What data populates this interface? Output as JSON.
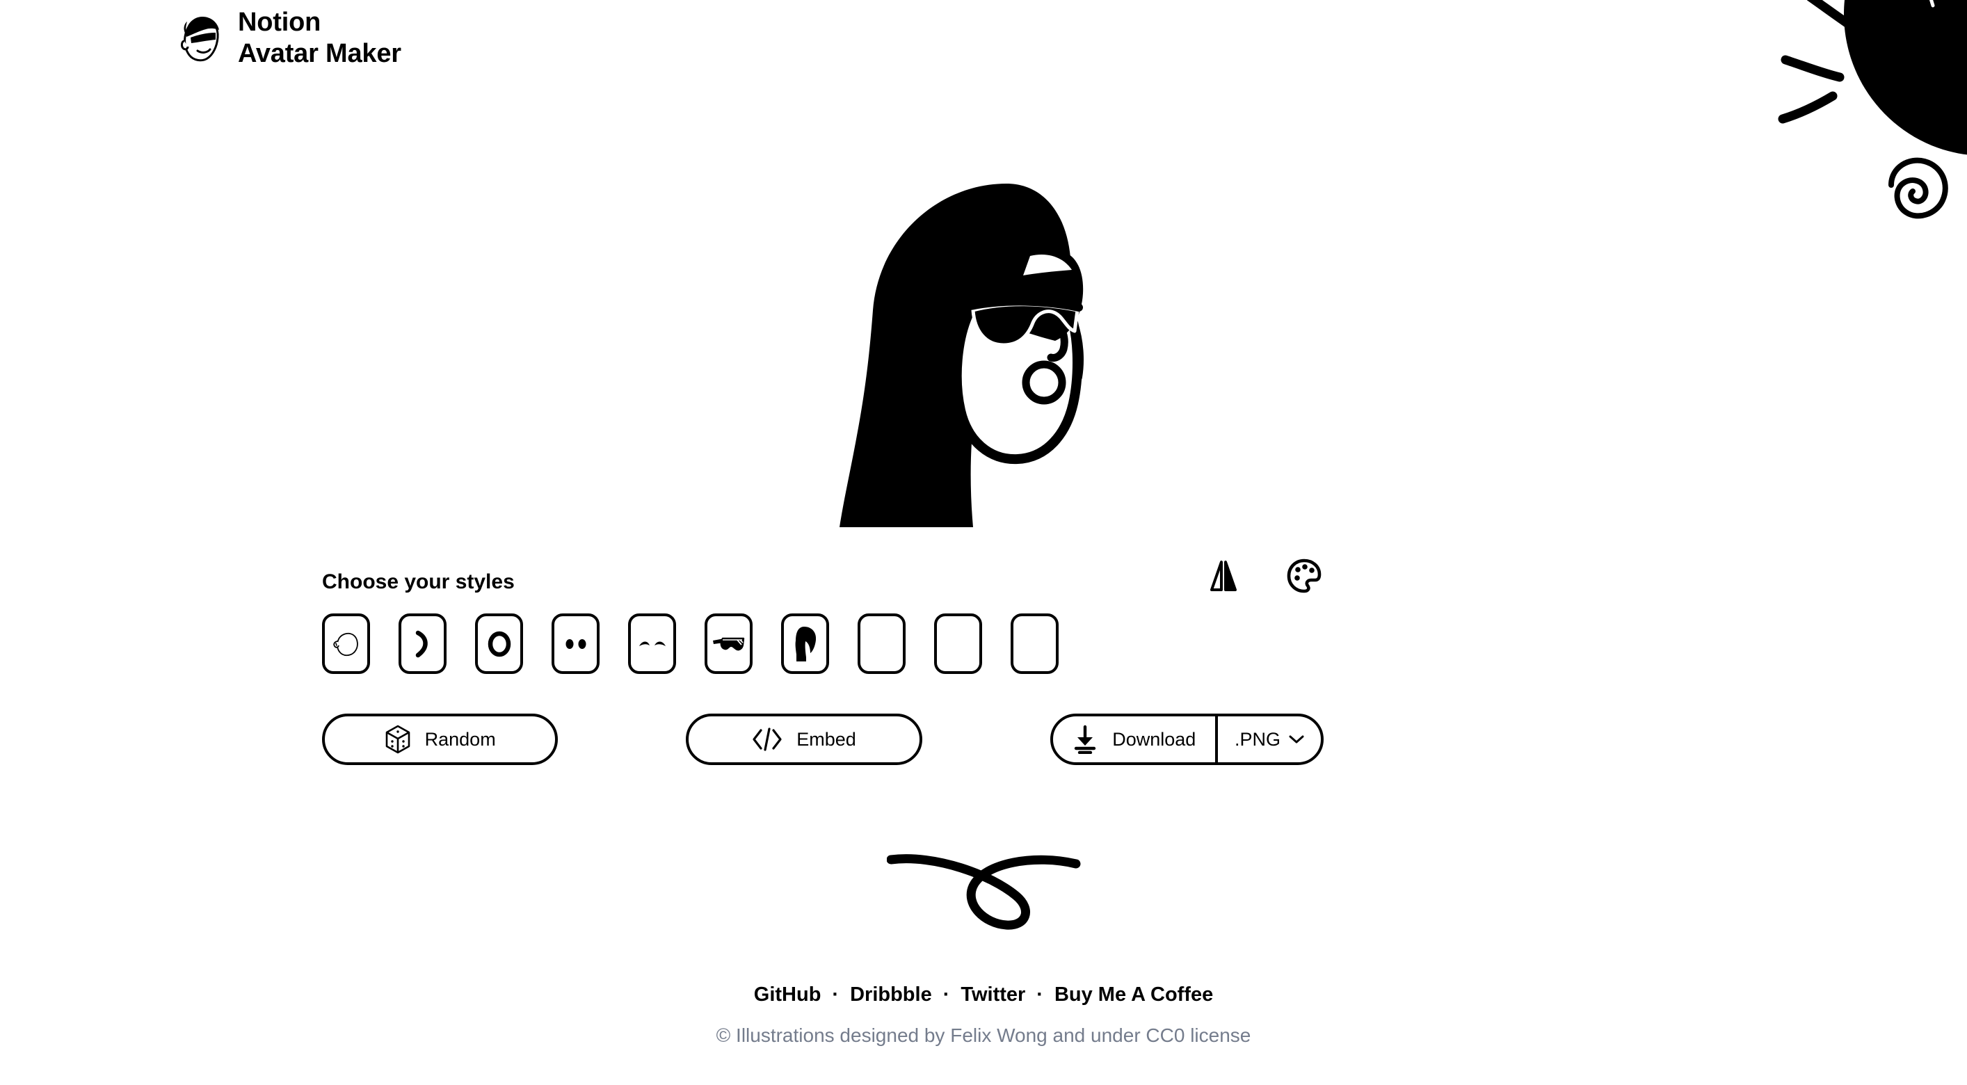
{
  "header": {
    "logo_icon": "notion-avatar-face-logo",
    "title_line1": "Notion",
    "title_line2": "Avatar Maker"
  },
  "decorations": [
    {
      "name": "dash-strokes",
      "icon": "three-curved-dashes"
    },
    {
      "name": "ink-blob",
      "icon": "large-black-blob"
    },
    {
      "name": "spiral",
      "icon": "hand-drawn-spiral"
    },
    {
      "name": "loop-swoosh",
      "icon": "hand-drawn-loop"
    }
  ],
  "preview": {
    "alt": "avatar-preview",
    "description": "Profile avatar with long black hair, dark goggles glasses and round open mouth"
  },
  "editor": {
    "section_title": "Choose your styles",
    "tools": [
      {
        "name": "flip-button",
        "icon": "flip-horizontal-icon"
      },
      {
        "name": "palette-button",
        "icon": "color-palette-icon"
      }
    ],
    "styles": [
      {
        "name": "style-face",
        "icon": "face-shape-icon"
      },
      {
        "name": "style-nose",
        "icon": "nose-crescent-icon"
      },
      {
        "name": "style-mouth",
        "icon": "mouth-ring-icon"
      },
      {
        "name": "style-eyes",
        "icon": "eyes-dots-icon"
      },
      {
        "name": "style-eyebrows",
        "icon": "eyebrows-arch-icon"
      },
      {
        "name": "style-glasses",
        "icon": "goggles-icon"
      },
      {
        "name": "style-hair",
        "icon": "long-hair-icon"
      },
      {
        "name": "style-beard",
        "icon": "empty-icon"
      },
      {
        "name": "style-accessories",
        "icon": "empty-icon"
      },
      {
        "name": "style-details",
        "icon": "empty-icon"
      }
    ]
  },
  "actions": {
    "random_label": "Random",
    "random_icon": "dice-icon",
    "embed_label": "Embed",
    "embed_icon": "code-brackets-icon",
    "download_label": "Download",
    "download_icon": "download-arrow-icon",
    "format_label": ".PNG",
    "format_caret_icon": "chevron-down-icon"
  },
  "footer": {
    "links": [
      {
        "label": "GitHub"
      },
      {
        "label": "Dribbble"
      },
      {
        "label": "Twitter"
      },
      {
        "label": "Buy Me A Coffee"
      }
    ],
    "separator": "·",
    "copyright": "© Illustrations designed by Felix Wong and under CC0 license"
  },
  "colors": {
    "background": "#ffffff",
    "ink": "#000000",
    "muted_text": "#747c8c"
  }
}
